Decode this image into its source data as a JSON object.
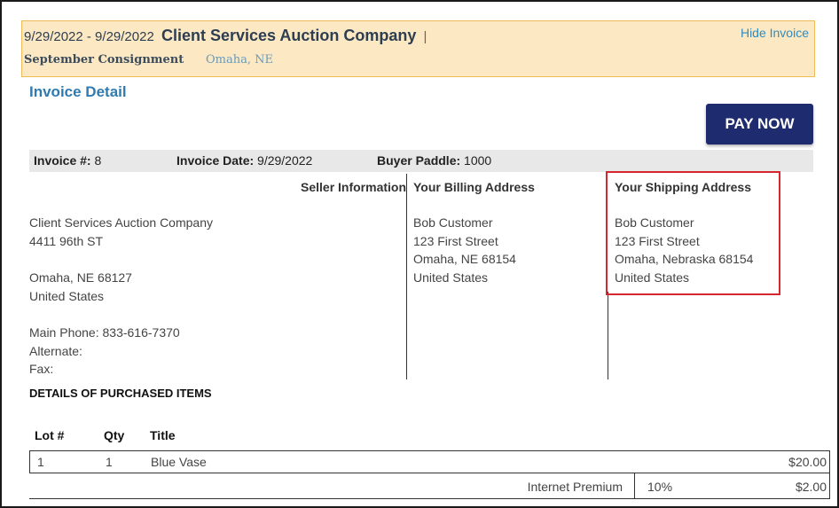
{
  "banner": {
    "dates": "9/29/2022 - 9/29/2022",
    "company": "Client Services Auction Company",
    "separator": "|",
    "consignment": "September Consignment",
    "location": "Omaha, NE",
    "hide_link": "Hide Invoice"
  },
  "section_title": "Invoice Detail",
  "pay_button": "PAY NOW",
  "invoice_meta": {
    "invoice_label": "Invoice #:",
    "invoice_value": "8",
    "date_label": "Invoice Date:",
    "date_value": "9/29/2022",
    "paddle_label": "Buyer Paddle:",
    "paddle_value": "1000"
  },
  "seller": {
    "heading": "Seller Information",
    "name": "Client Services Auction Company",
    "street": "4411 96th ST",
    "city_state_zip": "Omaha, NE  68127",
    "country": "United States",
    "main_phone": "Main Phone: 833-616-7370",
    "alternate": "Alternate:",
    "fax": "Fax:"
  },
  "billing": {
    "heading": "Your Billing Address",
    "name": "Bob Customer",
    "street": "123 First Street",
    "city_state_zip": "Omaha, NE  68154",
    "country": "United States"
  },
  "shipping": {
    "heading": "Your Shipping Address",
    "name": "Bob Customer",
    "street": "123 First Street",
    "city_state_zip": "Omaha, Nebraska  68154",
    "country": "United States"
  },
  "items": {
    "heading": "DETAILS OF PURCHASED ITEMS",
    "columns": [
      "Lot #",
      "Qty",
      "Title"
    ],
    "rows": [
      {
        "lot": "1",
        "qty": "1",
        "title": "Blue Vase",
        "amount": "$20.00"
      }
    ],
    "premium": {
      "label": "Internet Premium",
      "rate": "10%",
      "amount": "$2.00"
    }
  },
  "colors": {
    "banner_bg": "#fce8c3",
    "banner_border": "#f0b95a",
    "accent_link": "#2e7bb5",
    "pay_button_bg": "#1f2b6f",
    "highlight_box": "#d6262e"
  }
}
